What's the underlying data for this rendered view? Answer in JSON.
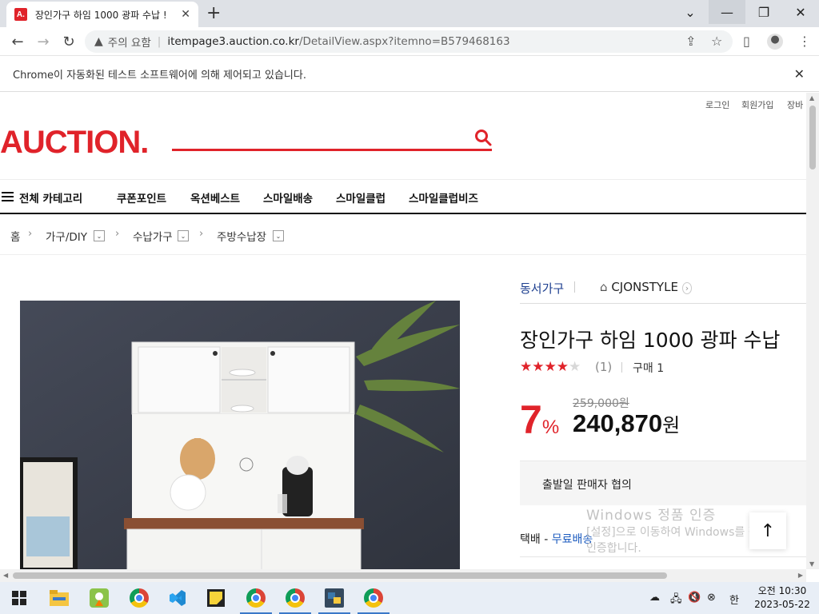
{
  "browser": {
    "tab_title": "장인가구 하임 1000 광파 수납 !",
    "tab_favicon": "A.",
    "security_label": "주의 요함",
    "url_host": "itempage3.auction.co.kr",
    "url_path": "/DetailView.aspx?itemno=B579468163",
    "infobar_text": "Chrome이 자동화된 테스트 소프트웨어에 의해 제어되고 있습니다."
  },
  "site": {
    "util_links": [
      "로그인",
      "회원가입",
      "장바"
    ],
    "logo": "AUCTION.",
    "all_categories": "전체 카테고리",
    "gnb": [
      "쿠폰포인트",
      "옥션베스트",
      "스마일배송",
      "스마일클럽",
      "스마일클럽비즈"
    ],
    "breadcrumb": {
      "home": "홈",
      "items": [
        "가구/DIY",
        "수납가구",
        "주방수납장"
      ]
    }
  },
  "product": {
    "brand": "동서가구",
    "store": "CJONSTYLE",
    "title": "장인가구 하임 1000 광파 수납",
    "rating": 4,
    "review_count": "(1)",
    "purchase": "구매 1",
    "discount": "7",
    "discount_unit": "%",
    "original_price": "259,000원",
    "price": "240,870",
    "price_unit": "원",
    "ship_info": "출발일 판매자 협의",
    "delivery_label": "택배 - ",
    "delivery_free": "무료배송"
  },
  "overlay": {
    "watermark_title": "Windows 정품 인증",
    "watermark_line1": "[설정]으로 이동하여 Windows를 정품",
    "watermark_line2": "인증합니다."
  },
  "taskbar": {
    "time": "오전 10:30",
    "date": "2023-05-22",
    "ime": "한"
  },
  "colors": {
    "auction_red": "#e0232a",
    "brand_blue": "#1c3e8f"
  }
}
